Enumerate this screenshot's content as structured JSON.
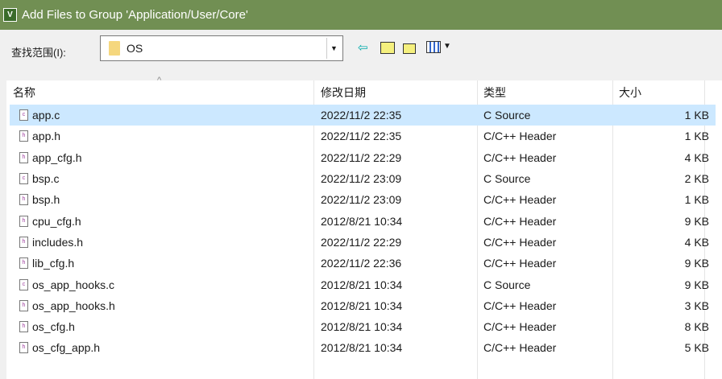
{
  "title": "Add Files to Group 'Application/User/Core'",
  "look_in_label": "查找范围(I):",
  "look_in_value": "OS",
  "columns": {
    "name": "名称",
    "date": "修改日期",
    "type": "类型",
    "size": "大小"
  },
  "files": [
    {
      "name": "app.c",
      "date": "2022/11/2 22:35",
      "type": "C Source",
      "size": "1 KB",
      "icon": "c"
    },
    {
      "name": "app.h",
      "date": "2022/11/2 22:35",
      "type": "C/C++ Header",
      "size": "1 KB",
      "icon": "h"
    },
    {
      "name": "app_cfg.h",
      "date": "2022/11/2 22:29",
      "type": "C/C++ Header",
      "size": "4 KB",
      "icon": "h"
    },
    {
      "name": "bsp.c",
      "date": "2022/11/2 23:09",
      "type": "C Source",
      "size": "2 KB",
      "icon": "c"
    },
    {
      "name": "bsp.h",
      "date": "2022/11/2 23:09",
      "type": "C/C++ Header",
      "size": "1 KB",
      "icon": "h"
    },
    {
      "name": "cpu_cfg.h",
      "date": "2012/8/21 10:34",
      "type": "C/C++ Header",
      "size": "9 KB",
      "icon": "h"
    },
    {
      "name": "includes.h",
      "date": "2022/11/2 22:29",
      "type": "C/C++ Header",
      "size": "4 KB",
      "icon": "h"
    },
    {
      "name": "lib_cfg.h",
      "date": "2022/11/2 22:36",
      "type": "C/C++ Header",
      "size": "9 KB",
      "icon": "h"
    },
    {
      "name": "os_app_hooks.c",
      "date": "2012/8/21 10:34",
      "type": "C Source",
      "size": "9 KB",
      "icon": "c"
    },
    {
      "name": "os_app_hooks.h",
      "date": "2012/8/21 10:34",
      "type": "C/C++ Header",
      "size": "3 KB",
      "icon": "h"
    },
    {
      "name": "os_cfg.h",
      "date": "2012/8/21 10:34",
      "type": "C/C++ Header",
      "size": "8 KB",
      "icon": "h"
    },
    {
      "name": "os_cfg_app.h",
      "date": "2012/8/21 10:34",
      "type": "C/C++ Header",
      "size": "5 KB",
      "icon": "h"
    }
  ]
}
